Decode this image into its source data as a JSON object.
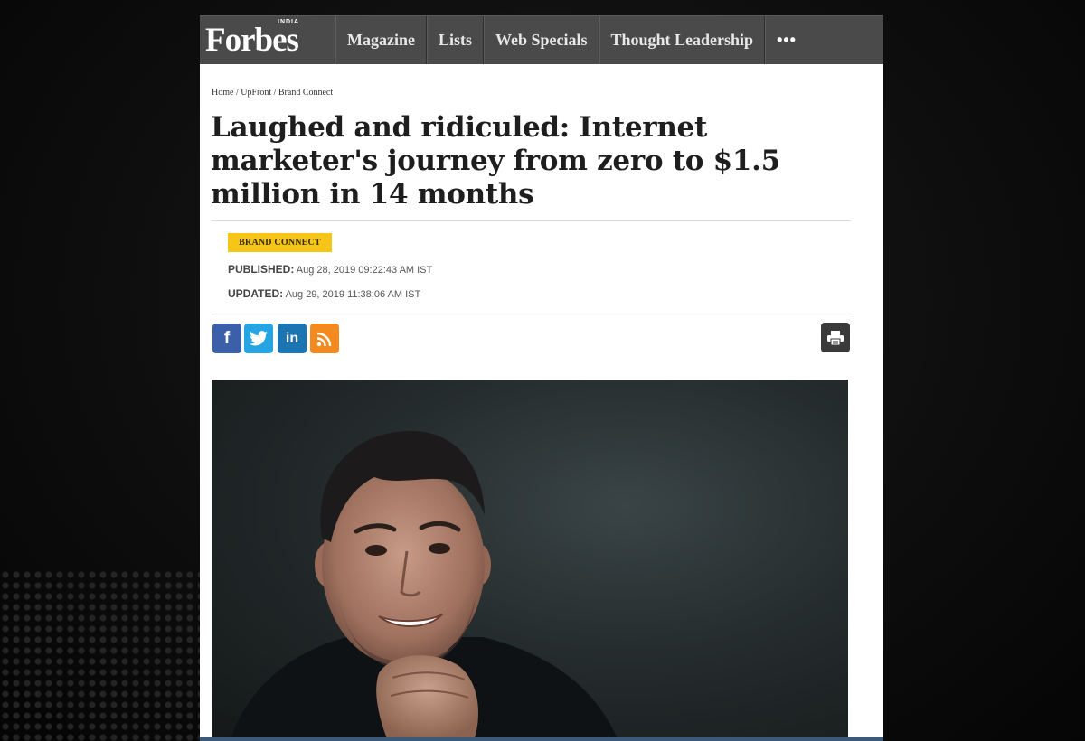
{
  "site": {
    "logo_text": "Forbes",
    "logo_edition": "INDIA",
    "nav": [
      "Magazine",
      "Lists",
      "Web Specials",
      "Thought Leadership"
    ],
    "more_label": "•••"
  },
  "article": {
    "breadcrumb": "Home / UpFront / Brand Connect",
    "headline": "Laughed and ridiculed: Internet marketer's journey from zero to $1.5 million in 14 months",
    "badge": "BRAND CONNECT",
    "published_label": "PUBLISHED:",
    "published_value": "Aug 28, 2019 09:22:43 AM IST",
    "updated_label": "UPDATED:",
    "updated_value": "Aug 29, 2019 11:38:06 AM IST"
  },
  "share": {
    "facebook_glyph": "f",
    "linkedin_glyph": "in",
    "icons": [
      "facebook-icon",
      "twitter-icon",
      "linkedin-icon",
      "rss-icon",
      "print-icon"
    ]
  },
  "colors": {
    "nav_bg": "#4a4a4a",
    "badge": "#f5c518",
    "facebook": "#3b5fa8",
    "twitter": "#27a5e3",
    "linkedin": "#1b75b3",
    "rss": "#f28a1f"
  }
}
